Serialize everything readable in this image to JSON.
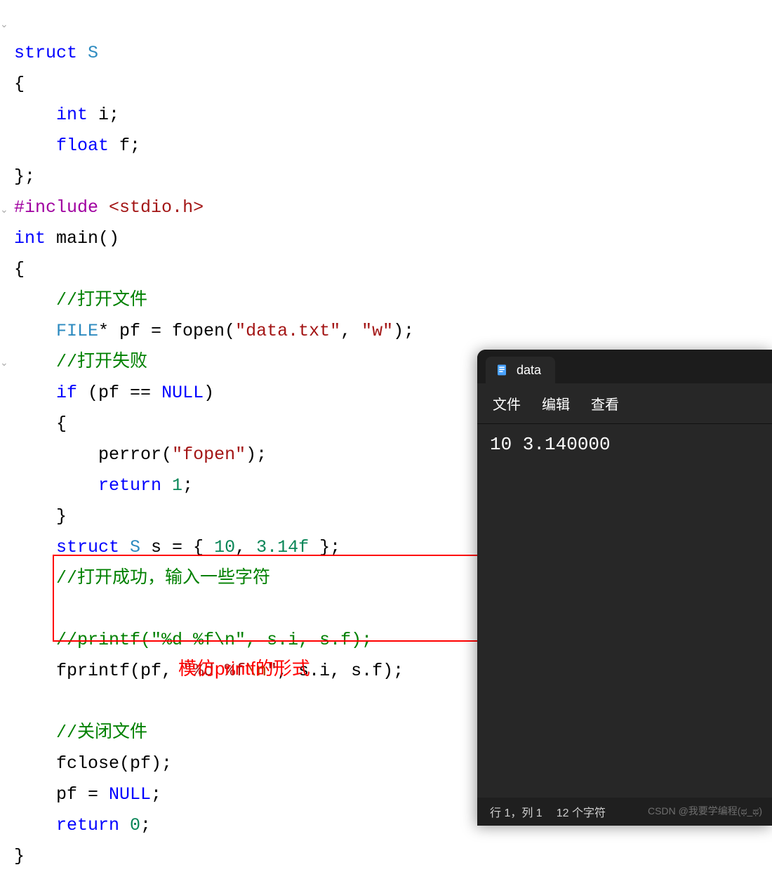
{
  "code": {
    "l1_struct": "struct",
    "l1_name": "S",
    "l2": "{",
    "l3_kw": "int",
    "l3_id": " i;",
    "l4_kw": "float",
    "l4_id": " f;",
    "l5": "};",
    "l6_inc": "#include",
    "l6_hdr": "<stdio.h>",
    "l7_int": "int",
    "l7_main": " main()",
    "l8": "{",
    "l9_c": "//打开文件",
    "l10_file": "FILE",
    "l10_rest": "* pf = fopen(",
    "l10_s1": "\"data.txt\"",
    "l10_mid": ", ",
    "l10_s2": "\"w\"",
    "l10_end": ");",
    "l11_c": "//打开失败",
    "l12_if": "if",
    "l12_cond_a": " (pf == ",
    "l12_null": "NULL",
    "l12_cond_b": ")",
    "l13": "{",
    "l14_p": "perror(",
    "l14_s": "\"fopen\"",
    "l14_e": ");",
    "l15_ret": "return",
    "l15_v": " 1",
    "l15_e": ";",
    "l16": "}",
    "l17_struct": "struct",
    "l17_name": " S",
    "l17_rest_a": " s = { ",
    "l17_n1": "10",
    "l17_mid": ", ",
    "l17_n2": "3.14f",
    "l17_rest_b": " };",
    "l18_c": "//打开成功，输入一些字符",
    "l20_c": "//printf(\"%d %f\\n\", s.i, s.f);",
    "l21_fp": "fprintf(pf, ",
    "l21_s_a": "\"%d %f",
    "l21_esc": "\\n",
    "l21_s_b": "\"",
    "l21_rest": ", s.i, s.f);",
    "l23_c": "//关闭文件",
    "l24": "fclose(pf);",
    "l25_a": "pf = ",
    "l25_null": "NULL",
    "l25_b": ";",
    "l26_ret": "return",
    "l26_v": " 0",
    "l26_e": ";",
    "l27": "}"
  },
  "annotation": "模仿printf的形式",
  "notepad": {
    "tab_title": "data",
    "menu": {
      "file": "文件",
      "edit": "编辑",
      "view": "查看"
    },
    "content": "10 3.140000",
    "status_line": "行 1，列 1",
    "status_chars": "12 个字符"
  },
  "watermark": "CSDN @我要学编程(ಥ_ಥ)"
}
